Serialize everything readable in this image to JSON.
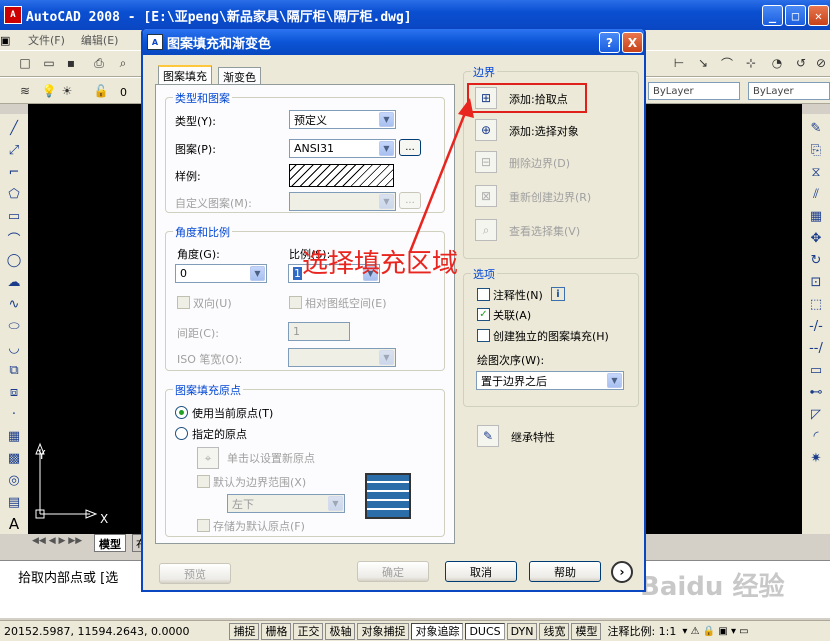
{
  "app": {
    "title": "AutoCAD 2008 - [E:\\亚peng\\新品家具\\隔厅柜\\隔厅柜.dwg]",
    "menu": [
      "文件(F)",
      "编辑(E)"
    ]
  },
  "toolbar": {
    "layer_value": "0",
    "bylayer_1": "ByLayer",
    "bylayer_2": "ByLayer"
  },
  "canvas": {
    "axis_y": "Y",
    "axis_x": "X",
    "tab_model": "模型",
    "tab_layout": "布"
  },
  "command": {
    "prompt": "拾取内部点或 [选"
  },
  "status": {
    "coords": "20152.5987, 11594.2643, 0.0000",
    "buttons": [
      "捕捉",
      "栅格",
      "正交",
      "极轴",
      "对象捕捉",
      "对象追踪",
      "DUCS",
      "DYN",
      "线宽",
      "模型"
    ],
    "scale_label": "注释比例: 1:1"
  },
  "dialog": {
    "title": "图案填充和渐变色",
    "help_btn": "?",
    "close_btn": "X",
    "tabs": [
      "图案填充",
      "渐变色"
    ],
    "type_pattern": {
      "group_title": "类型和图案",
      "type_label": "类型(Y):",
      "type_value": "预定义",
      "pattern_label": "图案(P):",
      "pattern_value": "ANSI31",
      "sample_label": "样例:",
      "custom_label": "自定义图案(M):"
    },
    "angle_scale": {
      "group_title": "角度和比例",
      "angle_label": "角度(G):",
      "angle_value": "0",
      "scale_label": "比例(S):",
      "scale_value": "1",
      "double_label": "双向(U)",
      "relative_label": "相对图纸空间(E)",
      "spacing_label": "间距(C):",
      "spacing_value": "1",
      "iso_label": "ISO 笔宽(O):"
    },
    "origin": {
      "group_title": "图案填充原点",
      "use_current": "使用当前原点(T)",
      "specified": "指定的原点",
      "click_set": "单击以设置新原点",
      "default_extent": "默认为边界范围(X)",
      "extent_value": "左下",
      "store_default": "存储为默认原点(F)"
    },
    "boundary": {
      "group_title": "边界",
      "add_pick": "添加:拾取点",
      "add_select": "添加:选择对象",
      "remove": "删除边界(D)",
      "recreate": "重新创建边界(R)",
      "view_select": "查看选择集(V)"
    },
    "options": {
      "group_title": "选项",
      "annotative": "注释性(N)",
      "associative": "关联(A)",
      "independent": "创建独立的图案填充(H)",
      "draw_order_label": "绘图次序(W):",
      "draw_order_value": "置于边界之后"
    },
    "inherit": "继承特性",
    "footer": {
      "preview": "预览",
      "ok": "确定",
      "cancel": "取消",
      "help": "帮助"
    }
  },
  "annotation": {
    "text": "选择填充区域"
  },
  "watermark": {
    "text": "Baidu 经验"
  }
}
